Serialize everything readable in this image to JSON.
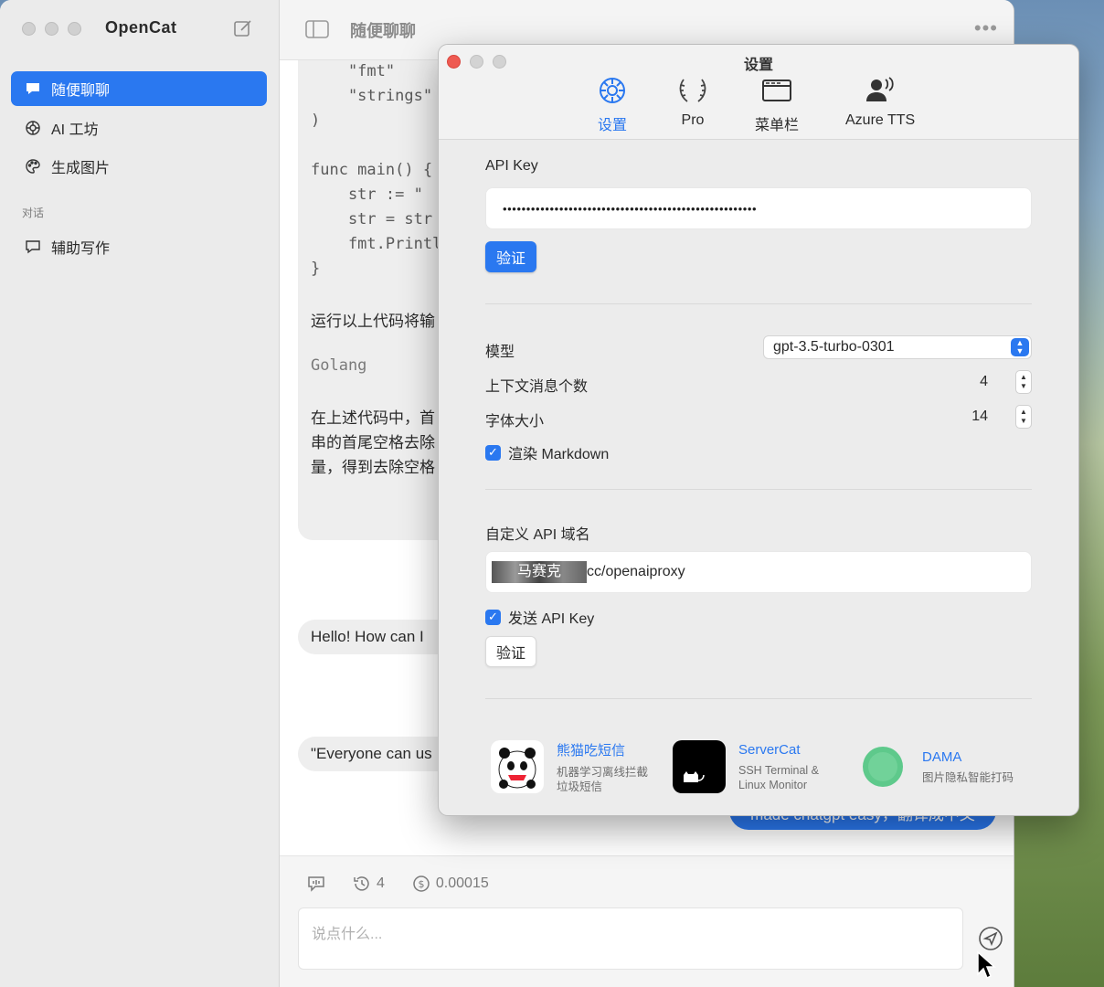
{
  "app": {
    "name": "OpenCat",
    "sidebar": {
      "items": [
        {
          "label": "随便聊聊",
          "icon": "chat-bubble-icon"
        },
        {
          "label": "AI 工坊",
          "icon": "openai-icon"
        },
        {
          "label": "生成图片",
          "icon": "palette-icon"
        }
      ],
      "section_label": "对话",
      "conversations": [
        {
          "label": "辅助写作",
          "icon": "chat-bubble-outline-icon"
        }
      ]
    },
    "chat": {
      "title": "随便聊聊",
      "code_lines": [
        "    \"fmt\"",
        "    \"strings\"",
        ")",
        "",
        "func main() {",
        "    str := \"",
        "    str = str",
        "    fmt.Printl",
        "}"
      ],
      "text_line_1": "运行以上代码将输",
      "mono_line": "Golang",
      "para_lines": [
        "在上述代码中，首",
        "串的首尾空格去除",
        "量，得到去除空格"
      ],
      "pill_1": "Hello! How can I",
      "pill_2": "\"Everyone can us",
      "user_bubble": "made chatgpt easy，翻译成中文"
    },
    "footer": {
      "context_count": "4",
      "cost": "0.00015",
      "input_placeholder": "说点什么..."
    }
  },
  "settings": {
    "title": "设置",
    "tabs": [
      {
        "label": "设置",
        "icon": "gear-icon",
        "selected": true
      },
      {
        "label": "Pro",
        "icon": "laurel-icon",
        "selected": false
      },
      {
        "label": "菜单栏",
        "icon": "menubar-window-icon",
        "selected": false
      },
      {
        "label": "Azure TTS",
        "icon": "speaker-person-icon",
        "selected": false
      }
    ],
    "api_key_label": "API Key",
    "api_key_value": "••••••••••••••••••••••••••••••••••••••••••••••••••••••",
    "verify_label": "验证",
    "model_label": "模型",
    "model_value": "gpt-3.5-turbo-0301",
    "context_label": "上下文消息个数",
    "context_value": "4",
    "font_size_label": "字体大小",
    "font_size_value": "14",
    "render_markdown_label": "渲染 Markdown",
    "render_markdown_checked": true,
    "custom_domain_label": "自定义 API 域名",
    "custom_domain_overlay": "马赛克",
    "custom_domain_suffix": "cc/openaiproxy",
    "send_api_key_label": "发送 API Key",
    "send_api_key_checked": true,
    "verify2_label": "验证",
    "promos": [
      {
        "title": "熊猫吃短信",
        "desc_1": "机器学习离线拦截",
        "desc_2": "垃圾短信"
      },
      {
        "title": "ServerCat",
        "desc_1": "SSH Terminal &",
        "desc_2": "Linux Monitor"
      },
      {
        "title": "DAMA",
        "desc_1": "图片隐私智能打码",
        "desc_2": ""
      }
    ]
  },
  "colors": {
    "accent": "#2a78f0",
    "close": "#ee5a52",
    "inactive": "#d0d0d0"
  }
}
